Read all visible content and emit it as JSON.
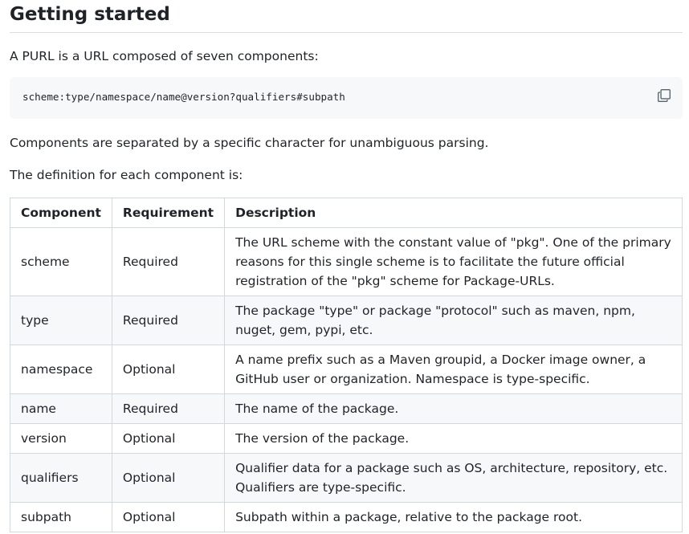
{
  "heading": "Getting started",
  "intro": "A PURL is a URL composed of seven components:",
  "code": {
    "text": "scheme:type/namespace/name@version?qualifiers#subpath",
    "copy_icon": "copy-icon"
  },
  "separator_note": "Components are separated by a specific character for unambiguous parsing.",
  "definition_intro": "The definition for each component is:",
  "table": {
    "headers": [
      "Component",
      "Requirement",
      "Description"
    ],
    "rows": [
      {
        "component": "scheme",
        "requirement": "Required",
        "description": "The URL scheme with the constant value of \"pkg\". One of the primary reasons for this single scheme is to facilitate the future official registration of the \"pkg\" scheme for Package-URLs."
      },
      {
        "component": "type",
        "requirement": "Required",
        "description": "The package \"type\" or package \"protocol\" such as maven, npm, nuget, gem, pypi, etc."
      },
      {
        "component": "namespace",
        "requirement": "Optional",
        "description": "A name prefix such as a Maven groupid, a Docker image owner, a GitHub user or organization. Namespace is type-specific."
      },
      {
        "component": "name",
        "requirement": "Required",
        "description": "The name of the package."
      },
      {
        "component": "version",
        "requirement": "Optional",
        "description": "The version of the package."
      },
      {
        "component": "qualifiers",
        "requirement": "Optional",
        "description": "Qualifier data for a package such as OS, architecture, repository, etc. Qualifiers are type-specific."
      },
      {
        "component": "subpath",
        "requirement": "Optional",
        "description": "Subpath within a package, relative to the package root."
      }
    ]
  }
}
